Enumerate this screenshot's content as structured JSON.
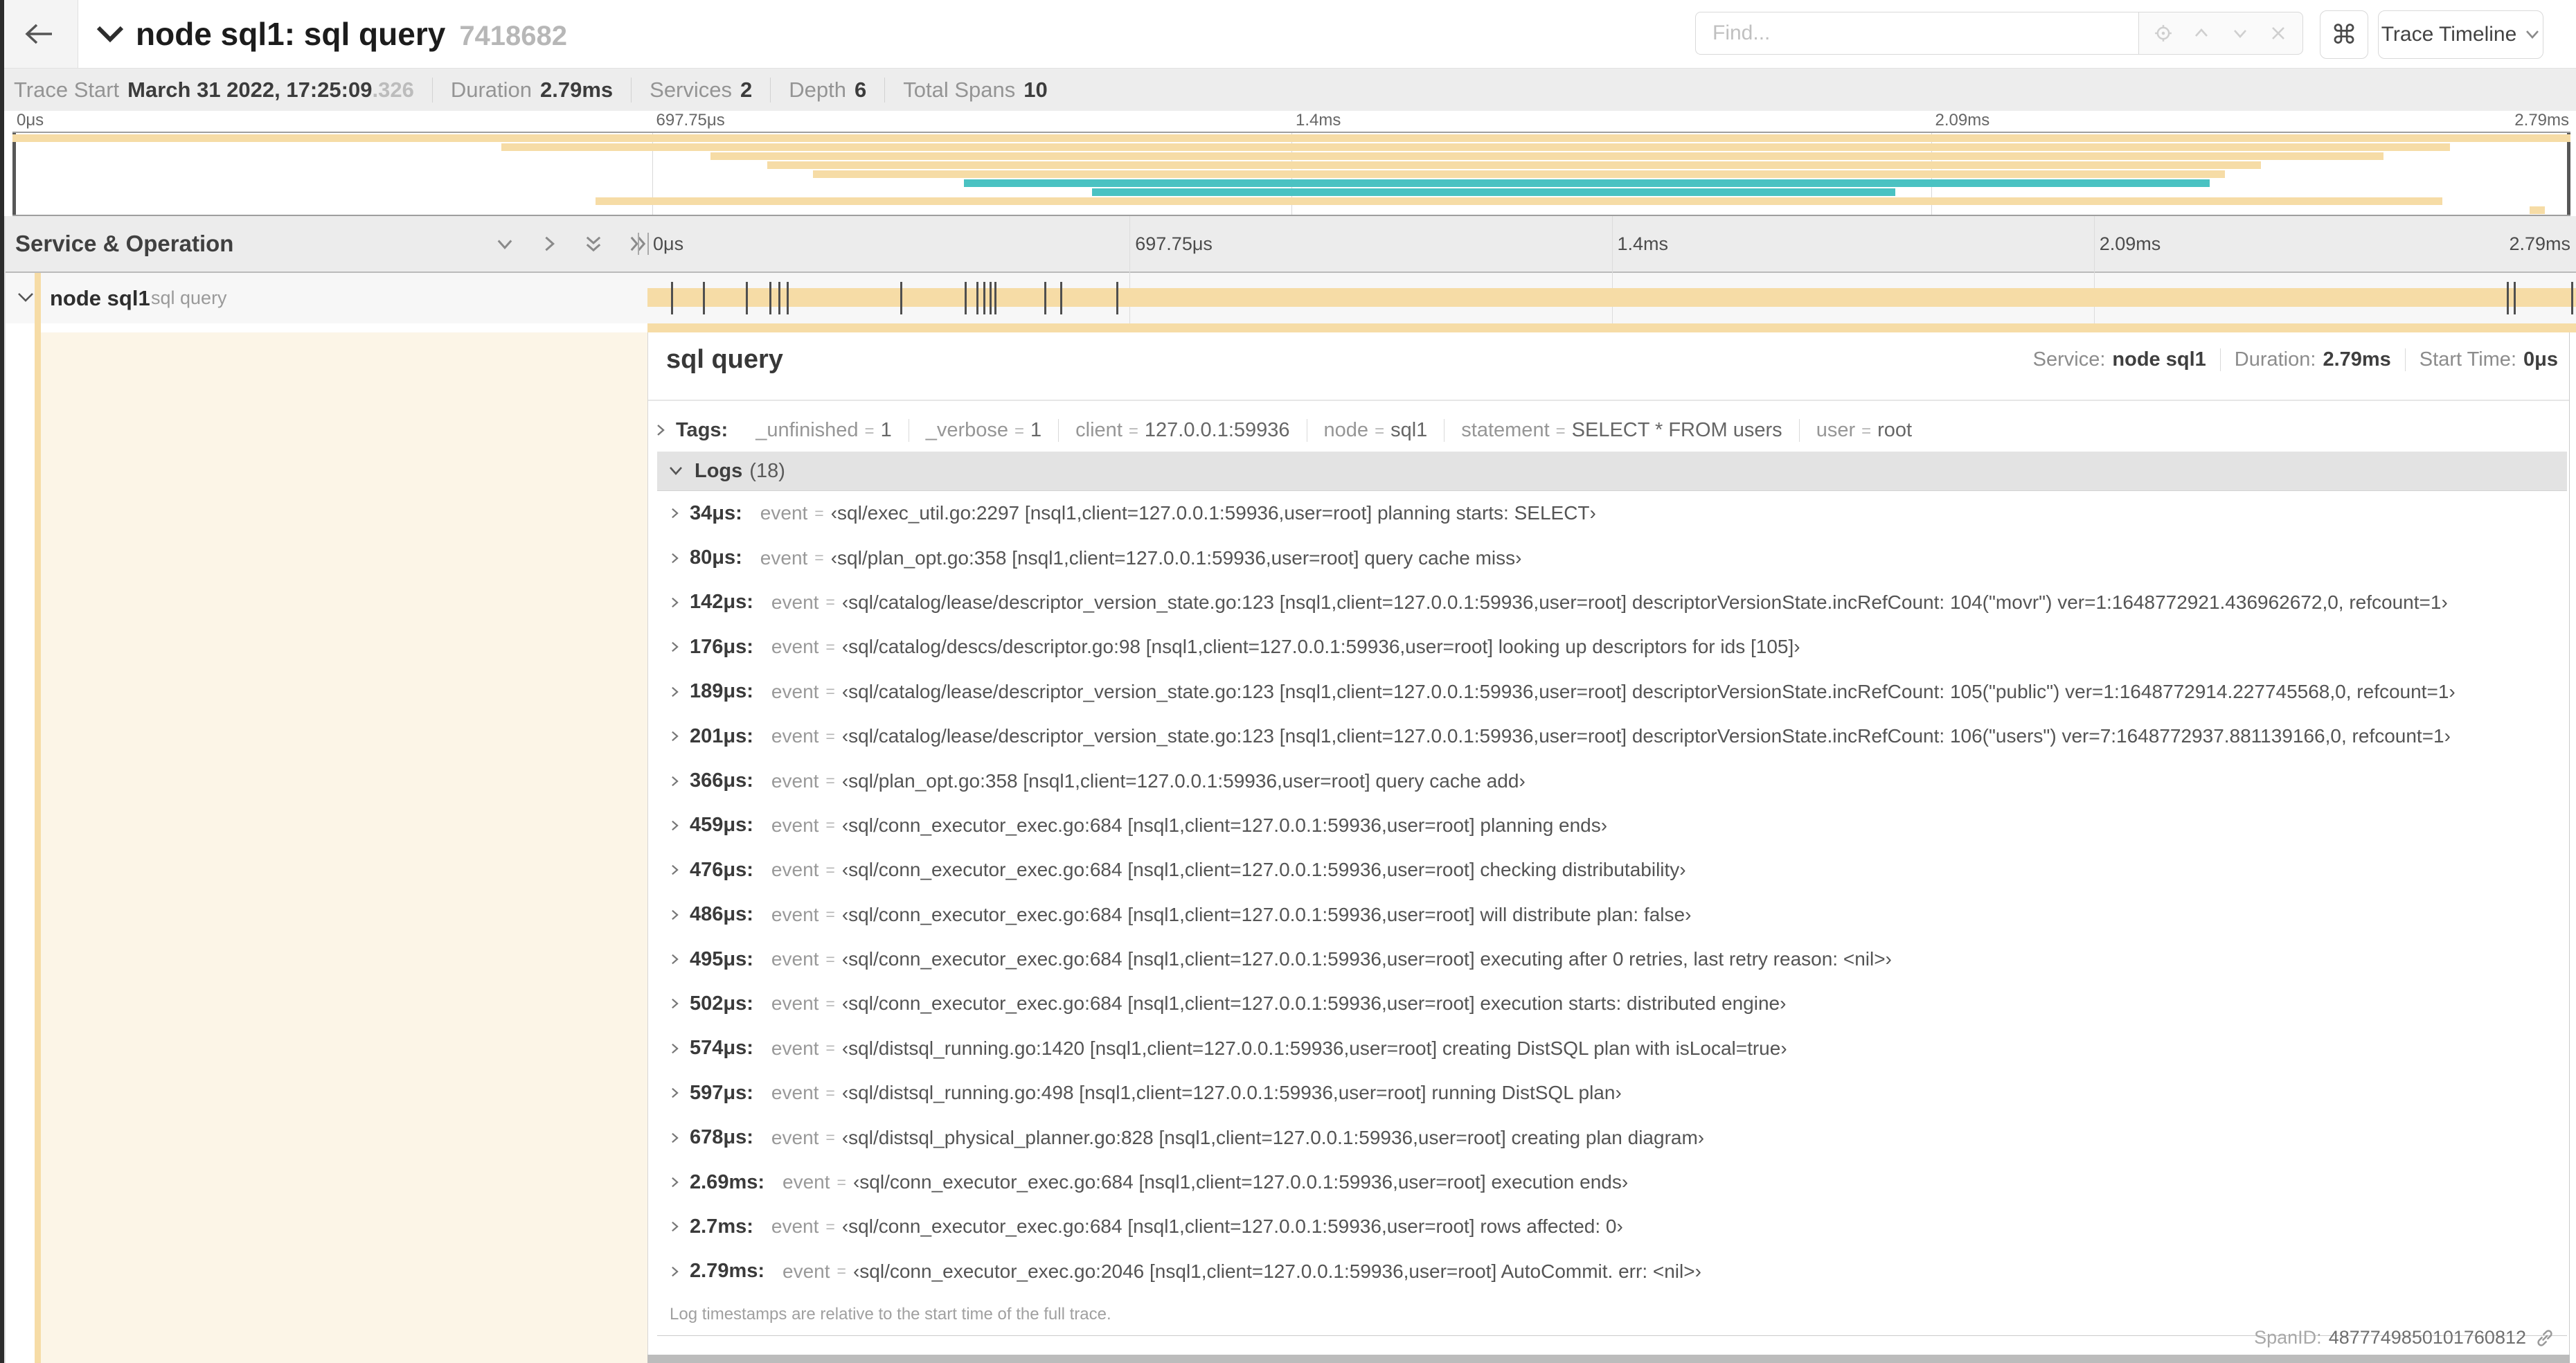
{
  "colors": {
    "tan": "#F6DCA6",
    "teal": "#4AC2C2",
    "cream": "#FCF5E7",
    "tick": "#4F4F4F"
  },
  "header": {
    "back_label": "back",
    "title": "node sql1: sql query",
    "trace_id": "7418682",
    "find_placeholder": "Find...",
    "shortcut_label": "⌘",
    "view_button_label": "Trace Timeline"
  },
  "summary": [
    {
      "label": "Trace Start",
      "value": "March 31 2022, 17:25:09",
      "suffix": ".326"
    },
    {
      "label": "Duration",
      "value": "2.79ms"
    },
    {
      "label": "Services",
      "value": "2"
    },
    {
      "label": "Depth",
      "value": "6"
    },
    {
      "label": "Total Spans",
      "value": "10"
    }
  ],
  "axis_ticks": [
    {
      "label": "0μs",
      "p": 0
    },
    {
      "label": "697.75μs",
      "p": 25
    },
    {
      "label": "1.4ms",
      "p": 50
    },
    {
      "label": "2.09ms",
      "p": 75
    },
    {
      "label": "2.79ms",
      "p": 100
    }
  ],
  "total_us": 2790,
  "minimap_spans": [
    {
      "color": "tan",
      "start": 0,
      "end": 100
    },
    {
      "color": "tan",
      "start": 19.1,
      "end": 95.3
    },
    {
      "color": "tan",
      "start": 27.3,
      "end": 92.7
    },
    {
      "color": "tan",
      "start": 29.5,
      "end": 87.9
    },
    {
      "color": "tan",
      "start": 31.3,
      "end": 86.5
    },
    {
      "color": "teal",
      "start": 37.2,
      "end": 85.9
    },
    {
      "color": "teal",
      "start": 42.2,
      "end": 73.6
    },
    {
      "color": "tan",
      "start": 22.8,
      "end": 95.0
    },
    {
      "color": "tan",
      "start": 98.4,
      "end": 99.0
    }
  ],
  "tree": {
    "header_label": "Service & Operation",
    "row": {
      "service": "node sql1",
      "operation": "sql query"
    }
  },
  "detail": {
    "title": "sql query",
    "meta": [
      {
        "label": "Service:",
        "value": "node sql1"
      },
      {
        "label": "Duration:",
        "value": "2.79ms"
      },
      {
        "label": "Start Time:",
        "value": "0μs"
      }
    ],
    "tags_label": "Tags:",
    "tags": [
      {
        "key": "_unfinished",
        "value": "1"
      },
      {
        "key": "_verbose",
        "value": "1"
      },
      {
        "key": "client",
        "value": "127.0.0.1:59936"
      },
      {
        "key": "node",
        "value": "sql1"
      },
      {
        "key": "statement",
        "value": "SELECT * FROM users"
      },
      {
        "key": "user",
        "value": "root"
      }
    ],
    "logs_label": "Logs",
    "logs_count": "(18)",
    "logs": [
      {
        "t": "34μs:",
        "us": 34,
        "k": "event",
        "v": "‹sql/exec_util.go:2297 [nsql1,client=127.0.0.1:59936,user=root] planning starts: SELECT›"
      },
      {
        "t": "80μs:",
        "us": 80,
        "k": "event",
        "v": "‹sql/plan_opt.go:358 [nsql1,client=127.0.0.1:59936,user=root] query cache miss›"
      },
      {
        "t": "142μs:",
        "us": 142,
        "k": "event",
        "v": "‹sql/catalog/lease/descriptor_version_state.go:123 [nsql1,client=127.0.0.1:59936,user=root] descriptorVersionState.incRefCount: 104(\"movr\") ver=1:1648772921.436962672,0, refcount=1›"
      },
      {
        "t": "176μs:",
        "us": 176,
        "k": "event",
        "v": "‹sql/catalog/descs/descriptor.go:98 [nsql1,client=127.0.0.1:59936,user=root] looking up descriptors for ids [105]›"
      },
      {
        "t": "189μs:",
        "us": 189,
        "k": "event",
        "v": "‹sql/catalog/lease/descriptor_version_state.go:123 [nsql1,client=127.0.0.1:59936,user=root] descriptorVersionState.incRefCount: 105(\"public\") ver=1:1648772914.227745568,0, refcount=1›"
      },
      {
        "t": "201μs:",
        "us": 201,
        "k": "event",
        "v": "‹sql/catalog/lease/descriptor_version_state.go:123 [nsql1,client=127.0.0.1:59936,user=root] descriptorVersionState.incRefCount: 106(\"users\") ver=7:1648772937.881139166,0, refcount=1›"
      },
      {
        "t": "366μs:",
        "us": 366,
        "k": "event",
        "v": "‹sql/plan_opt.go:358 [nsql1,client=127.0.0.1:59936,user=root] query cache add›"
      },
      {
        "t": "459μs:",
        "us": 459,
        "k": "event",
        "v": "‹sql/conn_executor_exec.go:684 [nsql1,client=127.0.0.1:59936,user=root] planning ends›"
      },
      {
        "t": "476μs:",
        "us": 476,
        "k": "event",
        "v": "‹sql/conn_executor_exec.go:684 [nsql1,client=127.0.0.1:59936,user=root] checking distributability›"
      },
      {
        "t": "486μs:",
        "us": 486,
        "k": "event",
        "v": "‹sql/conn_executor_exec.go:684 [nsql1,client=127.0.0.1:59936,user=root] will distribute plan: false›"
      },
      {
        "t": "495μs:",
        "us": 495,
        "k": "event",
        "v": "‹sql/conn_executor_exec.go:684 [nsql1,client=127.0.0.1:59936,user=root] executing after 0 retries, last retry reason: <nil>›"
      },
      {
        "t": "502μs:",
        "us": 502,
        "k": "event",
        "v": "‹sql/conn_executor_exec.go:684 [nsql1,client=127.0.0.1:59936,user=root] execution starts: distributed engine›"
      },
      {
        "t": "574μs:",
        "us": 574,
        "k": "event",
        "v": "‹sql/distsql_running.go:1420 [nsql1,client=127.0.0.1:59936,user=root] creating DistSQL plan with isLocal=true›"
      },
      {
        "t": "597μs:",
        "us": 597,
        "k": "event",
        "v": "‹sql/distsql_running.go:498 [nsql1,client=127.0.0.1:59936,user=root] running DistSQL plan›"
      },
      {
        "t": "678μs:",
        "us": 678,
        "k": "event",
        "v": "‹sql/distsql_physical_planner.go:828 [nsql1,client=127.0.0.1:59936,user=root] creating plan diagram›"
      },
      {
        "t": "2.69ms:",
        "us": 2690,
        "k": "event",
        "v": "‹sql/conn_executor_exec.go:684 [nsql1,client=127.0.0.1:59936,user=root] execution ends›"
      },
      {
        "t": "2.7ms:",
        "us": 2700,
        "k": "event",
        "v": "‹sql/conn_executor_exec.go:684 [nsql1,client=127.0.0.1:59936,user=root] rows affected: 0›"
      },
      {
        "t": "2.79ms:",
        "us": 2790,
        "k": "event",
        "v": "‹sql/conn_executor_exec.go:2046 [nsql1,client=127.0.0.1:59936,user=root] AutoCommit. err: <nil>›"
      }
    ],
    "footnote": "Log timestamps are relative to the start time of the full trace.",
    "span_id_label": "SpanID:",
    "span_id_value": "4877749850101760812"
  }
}
